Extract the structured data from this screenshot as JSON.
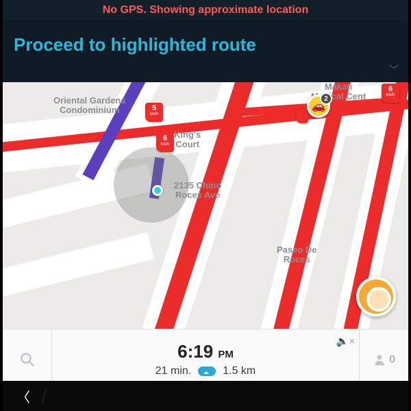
{
  "alert": "No GPS. Showing approximate location",
  "instruction": "Proceed to highlighted route",
  "poi": {
    "oriental": "Oriental Gardens\nCondominium",
    "kings": "King's\nCourt",
    "chino": "2135 Chino\nRoces Ave",
    "paseo": "Paseo De\nRoces",
    "makati": "Makati\nMedical Cent"
  },
  "speed": {
    "a": "5",
    "b": "6",
    "c": "6",
    "unit": "km/h"
  },
  "hazard_count": "2",
  "bottom": {
    "time": "6:19",
    "ampm": "PM",
    "eta": "21 min.",
    "dist": "1.5 km",
    "friends": "0"
  }
}
